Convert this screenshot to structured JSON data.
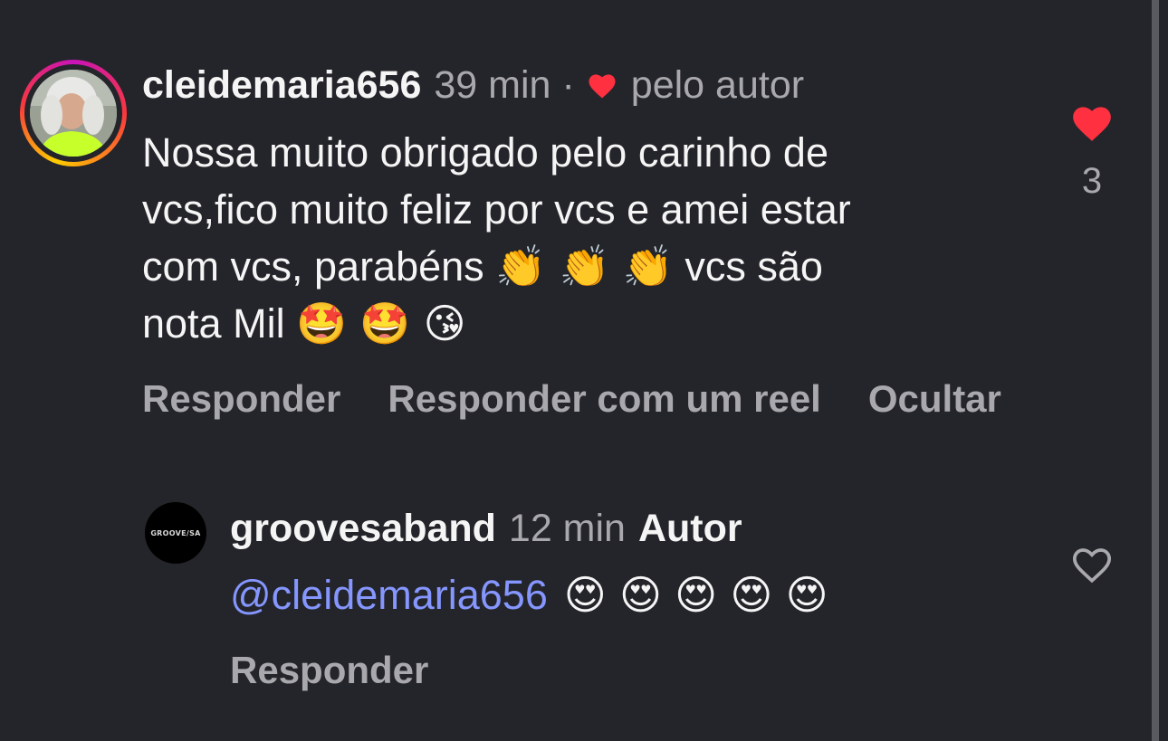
{
  "comments": [
    {
      "username": "cleidemaria656",
      "time": "39 min",
      "separator": "·",
      "liked_by_author_label": "pelo autor",
      "text": "Nossa muito obrigado pelo carinho de vcs,fico muito feliz por vcs e amei estar com vcs, parabéns 👏👏👏 vcs são nota Mil 🤩🤩😘",
      "line1": "Nossa muito obrigado pelo carinho de",
      "line2": "vcs,fico muito feliz por vcs e amei estar",
      "line3_text": "com vcs, parabéns ",
      "line3_emojis": "👏 👏 👏",
      "line3_tail": " vcs são",
      "line4_text": "nota Mil ",
      "line4_emojis": "🤩 🤩 😘",
      "like_count": "3",
      "liked": true,
      "actions": {
        "reply": "Responder",
        "reply_with_reel": "Responder com um reel",
        "hide": "Ocultar"
      },
      "avatar_icon": "user-photo"
    },
    {
      "username": "groovesaband",
      "time": "12 min",
      "author_tag": "Autor",
      "mention": "@cleidemaria656",
      "emojis": "😍 😍 😍 😍 😍",
      "avatar_logo_text": "GROOVE/SA",
      "liked": false,
      "actions": {
        "reply": "Responder"
      }
    }
  ],
  "colors": {
    "background": "#24252a",
    "like_red": "#ff3040",
    "mention_blue": "#8596ff",
    "secondary_text": "#a8a8ad"
  }
}
